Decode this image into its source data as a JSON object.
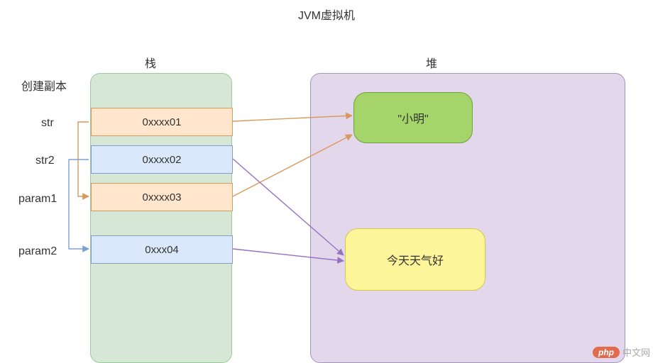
{
  "title": "JVM虚拟机",
  "stack": {
    "title": "栈",
    "copy_label": "创建副本",
    "vars": {
      "str": "str",
      "str2": "str2",
      "param1": "param1",
      "param2": "param2"
    },
    "cells": {
      "c1": "0xxxx01",
      "c2": "0xxxx02",
      "c3": "0xxxx03",
      "c4": "0xxx04"
    }
  },
  "heap": {
    "title": "堆",
    "obj1": "\"小明\"",
    "obj2": "今天天气好"
  },
  "watermark": {
    "logo": "php",
    "text": "中文网"
  },
  "colors": {
    "stack_bg": "#d6e8d5",
    "stack_border": "#97cc94",
    "heap_bg": "#e3d7ec",
    "heap_border": "#a593c0",
    "orange_bg": "#ffe6cc",
    "orange_border": "#d89a5e",
    "blue_bg": "#dbe8fb",
    "blue_border": "#7ea0d0",
    "obj1_bg": "#a5d46a",
    "obj1_border": "#6fa33a",
    "obj2_bg": "#fdf59a",
    "obj2_border": "#d6c946",
    "arrow_orange": "#d89a5e",
    "arrow_blue": "#7ea0d0",
    "arrow_purple": "#9673c0"
  },
  "chart_data": {
    "type": "diagram",
    "title": "JVM虚拟机",
    "regions": [
      {
        "name": "栈",
        "entries": [
          {
            "var": "str",
            "address": "0xxxx01",
            "points_to": "\"小明\"",
            "copy_of": null
          },
          {
            "var": "str2",
            "address": "0xxxx02",
            "points_to": "今天天气好",
            "copy_of": null
          },
          {
            "var": "param1",
            "address": "0xxxx03",
            "points_to": "\"小明\"",
            "copy_of": "str"
          },
          {
            "var": "param2",
            "address": "0xxx04",
            "points_to": "今天天气好",
            "copy_of": "str2"
          }
        ]
      },
      {
        "name": "堆",
        "objects": [
          "\"小明\"",
          "今天天气好"
        ]
      }
    ],
    "annotation": "创建副本"
  }
}
